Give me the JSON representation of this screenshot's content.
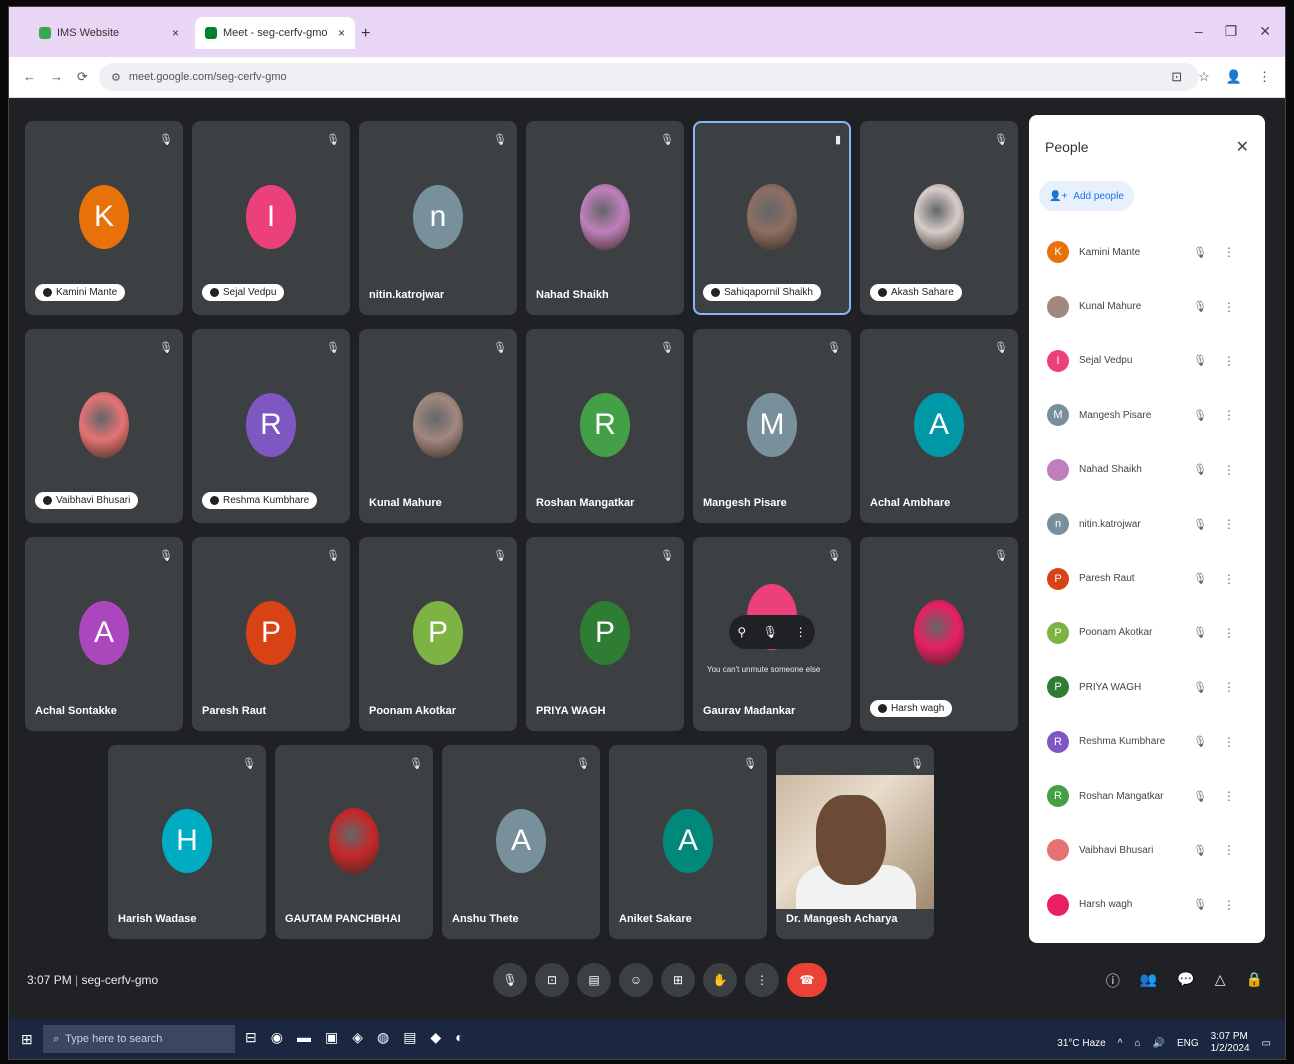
{
  "browser": {
    "tabs": [
      {
        "label": "IMS Website"
      },
      {
        "label": "Meet - seg-cerfv-gmo"
      }
    ],
    "new_tab": "+",
    "window_controls": [
      "–",
      "❐",
      "✕"
    ],
    "url": "meet.google.com/seg-cerfv-gmo",
    "nav": [
      "←",
      "→",
      "⟳"
    ],
    "addr_icons": [
      "⊡",
      "☆",
      "👤",
      "⋮"
    ]
  },
  "tiles": [
    {
      "name": "Kamini Mante",
      "initial": "K",
      "color": "#e8710a",
      "pill": true
    },
    {
      "name": "Sejal Vedpu",
      "initial": "I",
      "color": "#ec407a",
      "pill": true
    },
    {
      "name": "nitin.katrojwar",
      "initial": "n",
      "color": "#78909c",
      "pill": false
    },
    {
      "name": "Nahad Shaikh",
      "initial": "",
      "color": "#c07fbc",
      "pill": false,
      "photo": true
    },
    {
      "name": "Sahiqapornil Shaikh",
      "initial": "",
      "color": "#8d6e63",
      "pill": true,
      "photo": true
    },
    {
      "name": "Akash Sahare",
      "initial": "",
      "color": "#d7ccc8",
      "pill": true,
      "photo": true
    },
    {
      "name": "Vaibhavi Bhusari",
      "initial": "",
      "color": "#e57373",
      "pill": true,
      "photo": true
    },
    {
      "name": "Reshma Kumbhare",
      "initial": "R",
      "color": "#7e57c2",
      "pill": true
    },
    {
      "name": "Kunal Mahure",
      "initial": "",
      "color": "#a1887f",
      "pill": false,
      "photo": true
    },
    {
      "name": "Roshan Mangatkar",
      "initial": "R",
      "color": "#43a047",
      "pill": false
    },
    {
      "name": "Mangesh Pisare",
      "initial": "M",
      "color": "#78909c",
      "pill": false
    },
    {
      "name": "Achal Ambhare",
      "initial": "A",
      "color": "#0097a7",
      "pill": false
    },
    {
      "name": "Achal Sontakke",
      "initial": "A",
      "color": "#ab47bc",
      "pill": false
    },
    {
      "name": "Paresh Raut",
      "initial": "P",
      "color": "#d84315",
      "pill": false
    },
    {
      "name": "Poonam Akotkar",
      "initial": "P",
      "color": "#7cb342",
      "pill": false
    },
    {
      "name": "PRIYA WAGH",
      "initial": "P",
      "color": "#2e7d32",
      "pill": false
    },
    {
      "name": "Gaurav Madankar",
      "initial": "",
      "color": "#ec407a",
      "pill": false,
      "hover": true
    },
    {
      "name": "Harsh wagh",
      "initial": "",
      "color": "#e91e63",
      "pill": true,
      "photo": true
    },
    {
      "name": "Harish Wadase",
      "initial": "H",
      "color": "#00acc1",
      "pill": false
    },
    {
      "name": "GAUTAM PANCHBHAI",
      "initial": "",
      "color": "#c62828",
      "pill": false,
      "photo": true
    },
    {
      "name": "Anshu Thete",
      "initial": "A",
      "color": "#78909c",
      "pill": false
    },
    {
      "name": "Aniket Sakare",
      "initial": "A",
      "color": "#00897b",
      "pill": false
    },
    {
      "name": "Dr. Mangesh Acharya",
      "initial": "",
      "color": "#6b4a36",
      "pill": false,
      "video": true
    }
  ],
  "hover_note": "You can't unmute someone else",
  "people": {
    "title": "People",
    "add_people": "Add people",
    "list": [
      {
        "name": "Kamini Mante",
        "initial": "K",
        "color": "#e8710a"
      },
      {
        "name": "Kunal Mahure",
        "initial": "",
        "color": "#a1887f"
      },
      {
        "name": "Sejal Vedpu",
        "initial": "I",
        "color": "#ec407a"
      },
      {
        "name": "Mangesh Pisare",
        "initial": "M",
        "color": "#78909c"
      },
      {
        "name": "Nahad Shaikh",
        "initial": "",
        "color": "#c07fbc"
      },
      {
        "name": "nitin.katrojwar",
        "initial": "n",
        "color": "#78909c"
      },
      {
        "name": "Paresh Raut",
        "initial": "P",
        "color": "#d84315"
      },
      {
        "name": "Poonam Akotkar",
        "initial": "P",
        "color": "#7cb342"
      },
      {
        "name": "PRIYA WAGH",
        "initial": "P",
        "color": "#2e7d32"
      },
      {
        "name": "Reshma Kumbhare",
        "initial": "R",
        "color": "#7e57c2"
      },
      {
        "name": "Roshan Mangatkar",
        "initial": "R",
        "color": "#43a047"
      },
      {
        "name": "Vaibhavi Bhusari",
        "initial": "",
        "color": "#e57373"
      },
      {
        "name": "Harsh wagh",
        "initial": "",
        "color": "#e91e63"
      }
    ]
  },
  "bottom": {
    "time": "3:07 PM",
    "meeting_code": "seg-cerfv-gmo",
    "controls": [
      "🎙",
      "⊡",
      "▤",
      "☺",
      "⊞",
      "✋",
      "⋮"
    ],
    "end_call": "☎",
    "right": [
      "ⓘ",
      "👥",
      "💬",
      "△",
      "🔒"
    ]
  },
  "taskbar": {
    "start": "⊞",
    "search_placeholder": "Type here to search",
    "apps": [
      "⊟",
      "◉",
      "▬",
      "▣",
      "◈",
      "◍",
      "▤",
      "◆",
      "◐"
    ],
    "weather": "31°C Haze",
    "tray": [
      "^",
      "⌂",
      "🔊",
      "ENG",
      "3:07 PM"
    ],
    "date": "1/2/2024"
  }
}
